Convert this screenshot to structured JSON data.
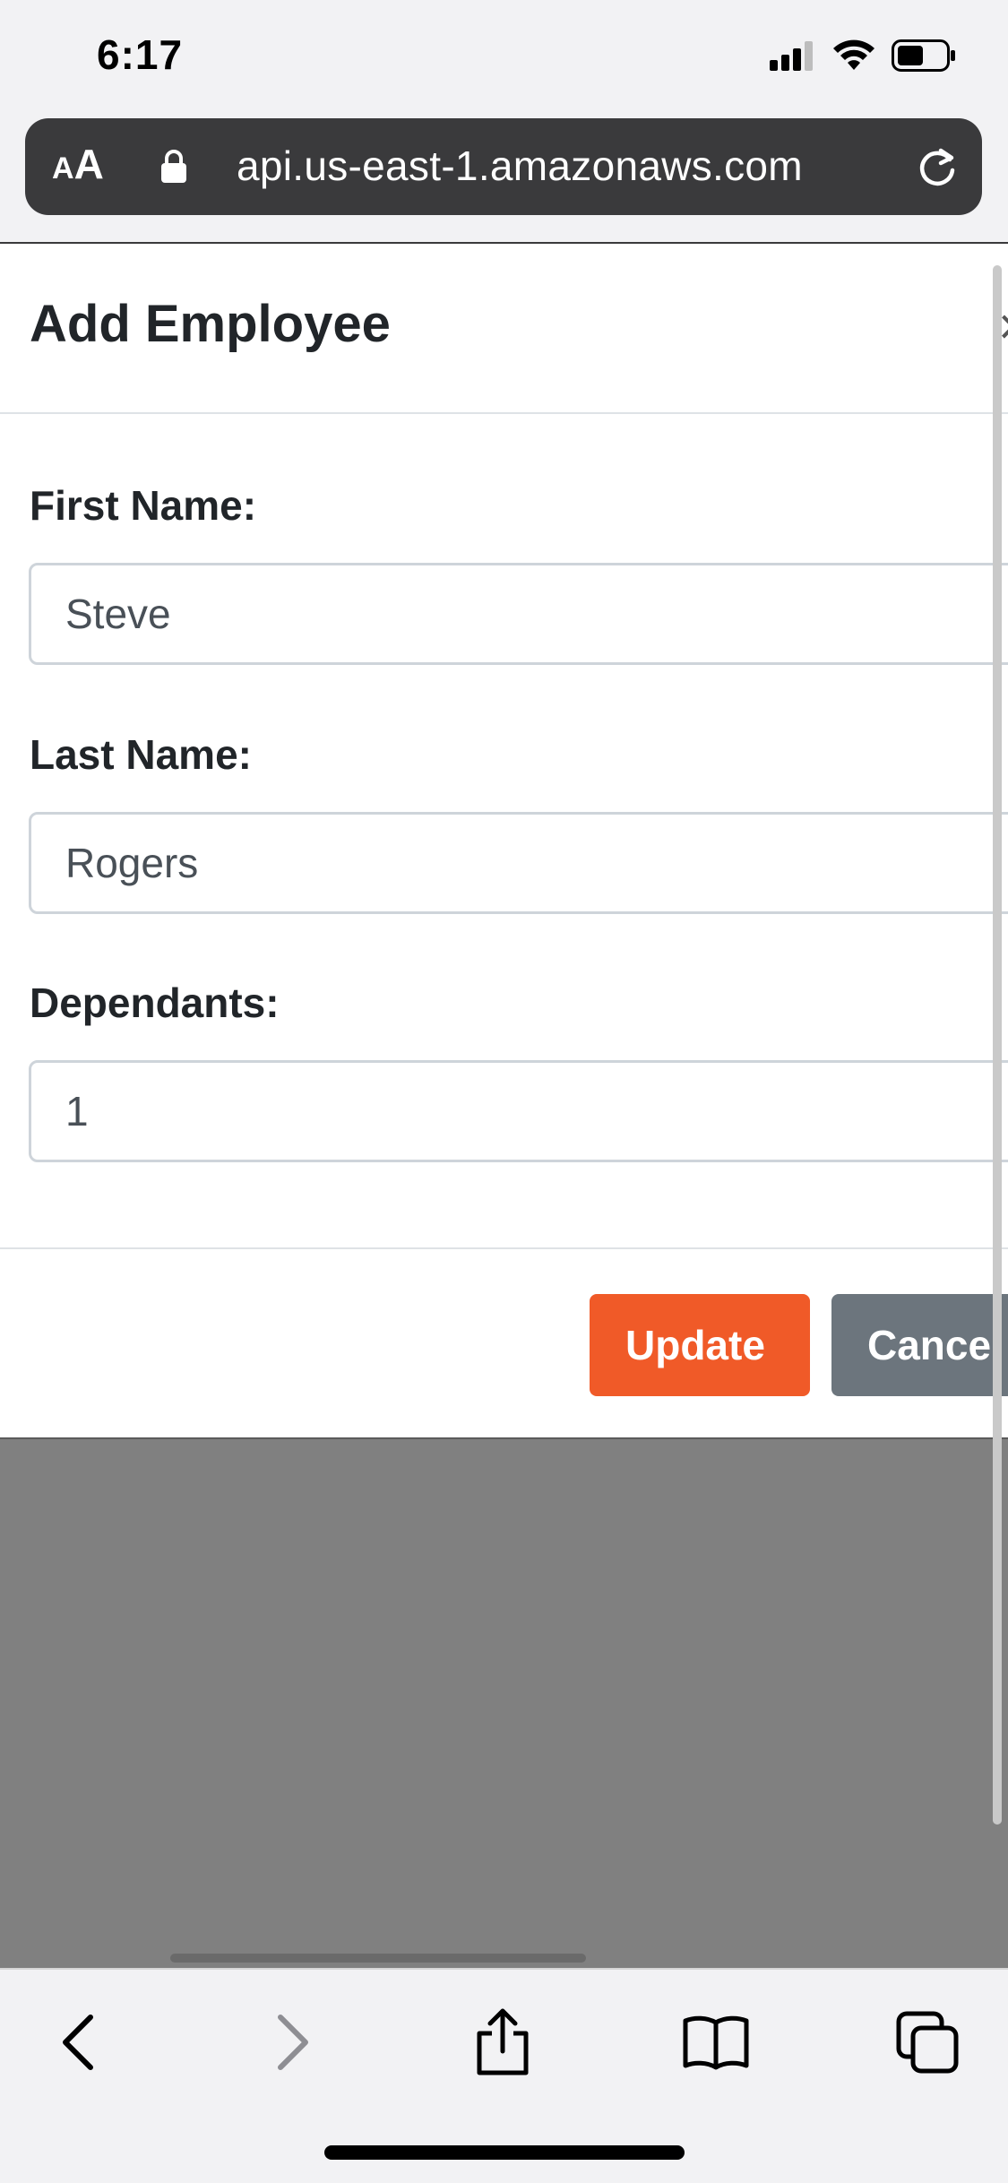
{
  "status_bar": {
    "time": "6:17",
    "icons": [
      "cellular-signal-icon",
      "wifi-icon",
      "battery-icon"
    ]
  },
  "browser": {
    "reader_label_small": "A",
    "reader_label_big": "A",
    "url": "api.us-east-1.amazonaws.com",
    "url_color": "#ffffff",
    "address_bar_color": "#3a3a3c"
  },
  "modal": {
    "title": "Add Employee",
    "close_glyph": "×",
    "fields": [
      {
        "label": "First Name:",
        "value": "Steve"
      },
      {
        "label": "Last Name:",
        "value": "Rogers"
      },
      {
        "label": "Dependants:",
        "value": "1"
      }
    ],
    "update_label": "Update",
    "cancel_label": "Cancel",
    "colors": {
      "update": "#f05a28",
      "cancel": "#6c757d",
      "overlay": "#808080"
    }
  },
  "toolbar": {
    "icons": [
      "back-icon",
      "forward-icon",
      "share-icon",
      "bookmarks-icon",
      "tabs-icon"
    ]
  }
}
